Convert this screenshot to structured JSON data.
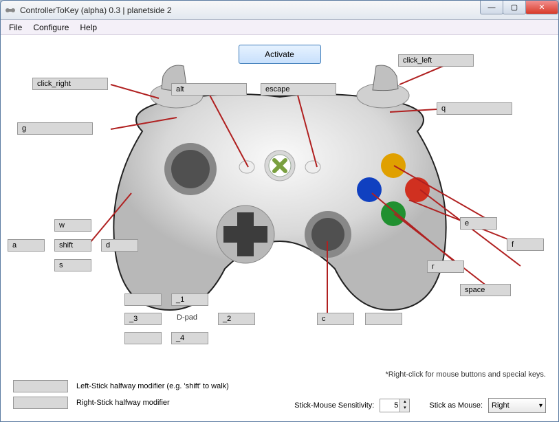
{
  "window": {
    "title": "ControllerToKey (alpha) 0.3 | planetside 2"
  },
  "menu": {
    "file": "File",
    "configure": "Configure",
    "help": "Help"
  },
  "activate": "Activate",
  "map": {
    "lt": "click_right",
    "rt": "click_left",
    "lb": "g",
    "rb": "q",
    "back": "alt",
    "start": "escape",
    "ls_up": "w",
    "ls_down": "s",
    "ls_left": "a",
    "ls_right": "d",
    "ls_click": "shift",
    "rs_click": "c",
    "btn_a": "space",
    "btn_b": "f",
    "btn_x": "r",
    "btn_y": "e",
    "dpad_up": "_1",
    "dpad_down": "_4",
    "dpad_left": "_3",
    "dpad_right": "_2",
    "dpad_label": "D-pad",
    "rs_extra": "",
    "face_extra1": "",
    "face_extra2": ""
  },
  "left_mod": {
    "value": "",
    "label": "Left-Stick halfway modifier (e.g. 'shift' to walk)"
  },
  "right_mod": {
    "value": "",
    "label": "Right-Stick halfway modifier"
  },
  "hint": "*Right-click for mouse buttons and special keys.",
  "sens": {
    "label": "Stick-Mouse Sensitivity:",
    "value": "5"
  },
  "stickmouse": {
    "label": "Stick as Mouse:",
    "value": "Right"
  }
}
